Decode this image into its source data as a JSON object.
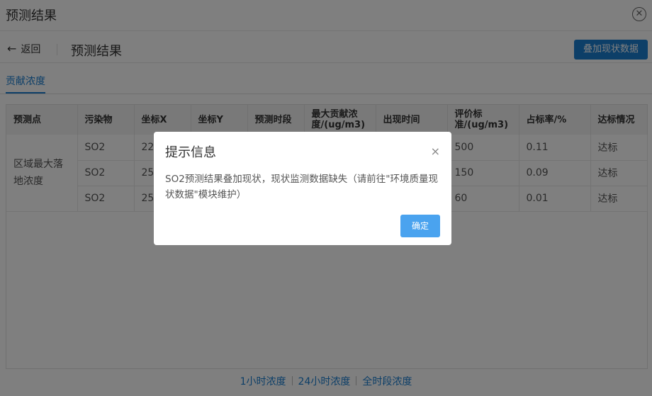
{
  "window": {
    "title": "预测结果",
    "close_icon": "✕"
  },
  "subbar": {
    "back_label": "返回",
    "back_icon": "←",
    "title": "预测结果",
    "overlay_button": "叠加现状数据"
  },
  "tabs": [
    {
      "label": "贡献浓度"
    }
  ],
  "table": {
    "headers": [
      "预测点",
      "污染物",
      "坐标X",
      "坐标Y",
      "预测时段",
      "最大贡献浓度/(ug/m3)",
      "出现时间",
      "评价标准/(ug/m3)",
      "占标率/%",
      "达标情况"
    ],
    "group_label": "区域最大落地浓度",
    "rows": [
      {
        "pollutant": "SO2",
        "x": "220",
        "y": "",
        "period": "",
        "max": "",
        "time": "",
        "standard": "500",
        "ratio": "0.11",
        "status": "达标"
      },
      {
        "pollutant": "SO2",
        "x": "250",
        "y": "",
        "period": "",
        "max": "",
        "time": "",
        "standard": "150",
        "ratio": "0.09",
        "status": "达标"
      },
      {
        "pollutant": "SO2",
        "x": "250",
        "y": "",
        "period": "",
        "max": "",
        "time": "",
        "standard": "60",
        "ratio": "0.01",
        "status": "达标"
      }
    ]
  },
  "footer_links": [
    "1小时浓度",
    "24小时浓度",
    "全时段浓度"
  ],
  "dialog": {
    "title": "提示信息",
    "close_icon": "×",
    "message": "SO2预测结果叠加现状，现状监测数据缺失（请前往\"环境质量现状数据\"模块维护）",
    "ok_label": "确定"
  },
  "colors": {
    "accent": "#1a7ed0",
    "ok_button": "#4aa3ef",
    "mask": "rgba(0,0,0,0.5)"
  }
}
